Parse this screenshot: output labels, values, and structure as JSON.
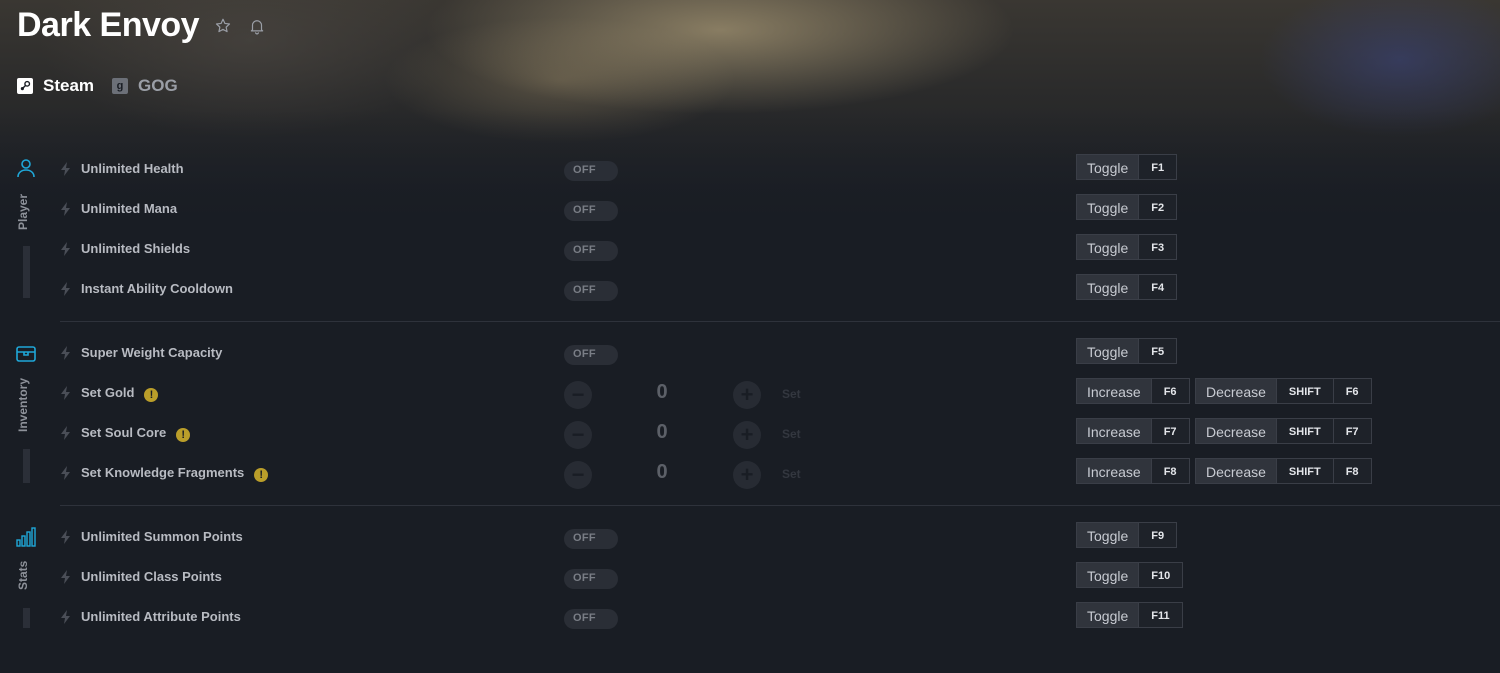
{
  "game": {
    "title": "Dark Envoy"
  },
  "platforms": [
    {
      "name": "Steam",
      "icon": "steam-icon",
      "active": true
    },
    {
      "name": "GOG",
      "icon": "gog-icon",
      "icon_letter": "g",
      "active": false
    }
  ],
  "categories": [
    {
      "name": "Player",
      "icon": "person-icon"
    },
    {
      "name": "Inventory",
      "icon": "chest-icon"
    },
    {
      "name": "Stats",
      "icon": "bar-chart-icon"
    }
  ],
  "cheats": [
    {
      "name": "Unlimited Health",
      "state": "OFF",
      "action": "Toggle",
      "key": "F1"
    },
    {
      "name": "Unlimited Mana",
      "state": "OFF",
      "action": "Toggle",
      "key": "F2"
    },
    {
      "name": "Unlimited Shields",
      "state": "OFF",
      "action": "Toggle",
      "key": "F3"
    },
    {
      "name": "Instant Ability Cooldown",
      "state": "OFF",
      "action": "Toggle",
      "key": "F4"
    },
    {
      "name": "Super Weight Capacity",
      "state": "OFF",
      "action": "Toggle",
      "key": "F5"
    },
    {
      "name": "Set Gold",
      "warning": "!",
      "value": "0",
      "set_label": "Set",
      "minus": "−",
      "plus": "+",
      "increase_label": "Increase",
      "increase_key": "F6",
      "decrease_label": "Decrease",
      "decrease_modifier": "SHIFT",
      "decrease_key": "F6"
    },
    {
      "name": "Set Soul Core",
      "warning": "!",
      "value": "0",
      "set_label": "Set",
      "minus": "−",
      "plus": "+",
      "increase_label": "Increase",
      "increase_key": "F7",
      "decrease_label": "Decrease",
      "decrease_modifier": "SHIFT",
      "decrease_key": "F7"
    },
    {
      "name": "Set Knowledge Fragments",
      "warning": "!",
      "value": "0",
      "set_label": "Set",
      "minus": "−",
      "plus": "+",
      "increase_label": "Increase",
      "increase_key": "F8",
      "decrease_label": "Decrease",
      "decrease_modifier": "SHIFT",
      "decrease_key": "F8"
    },
    {
      "name": "Unlimited Summon Points",
      "state": "OFF",
      "action": "Toggle",
      "key": "F9"
    },
    {
      "name": "Unlimited Class Points",
      "state": "OFF",
      "action": "Toggle",
      "key": "F10"
    },
    {
      "name": "Unlimited Attribute Points",
      "state": "OFF",
      "action": "Toggle",
      "key": "F11"
    }
  ],
  "colors": {
    "accent": "#1fa7d8",
    "warning": "#ba9e2a",
    "background": "#191d24"
  }
}
